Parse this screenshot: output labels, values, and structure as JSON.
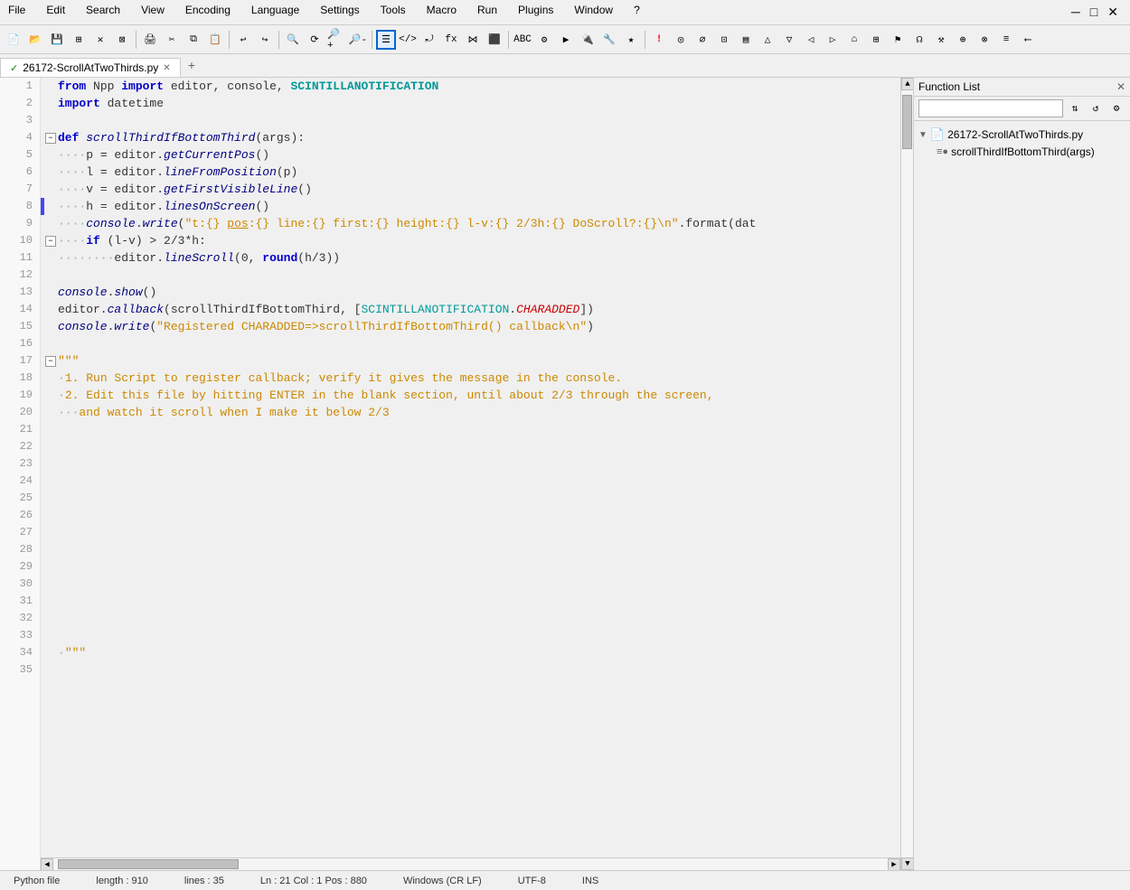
{
  "menubar": {
    "items": [
      "File",
      "Edit",
      "Search",
      "View",
      "Encoding",
      "Language",
      "Settings",
      "Tools",
      "Macro",
      "Run",
      "Plugins",
      "Window",
      "?"
    ]
  },
  "tabbar": {
    "tab": {
      "check": "✓",
      "filename": "26172-ScrollAtTwoThirds.py",
      "close": "✕"
    }
  },
  "function_list": {
    "title": "Function List",
    "close": "✕",
    "search_placeholder": "",
    "tree": {
      "file_icon": "📄",
      "filename": "26172-ScrollAtTwoThirds.py",
      "child_icon": "≡●",
      "child_name": "scrollThirdIfBottomThird(args)"
    }
  },
  "code": {
    "lines": [
      {
        "num": 1,
        "fold": false,
        "gutter": "none",
        "text": "from Npp import editor, console, SCINTILLANOTIFICATION",
        "type": "from"
      },
      {
        "num": 2,
        "fold": false,
        "gutter": "none",
        "text": "import datetime",
        "type": "import"
      },
      {
        "num": 3,
        "fold": false,
        "gutter": "none",
        "text": "",
        "type": "blank"
      },
      {
        "num": 4,
        "fold": true,
        "foldOpen": true,
        "gutter": "none",
        "text": "def scrollThirdIfBottomThird(args):",
        "type": "def"
      },
      {
        "num": 5,
        "fold": false,
        "gutter": "none",
        "text": "    p = editor.getCurrentPos()",
        "type": "code"
      },
      {
        "num": 6,
        "fold": false,
        "gutter": "none",
        "text": "    l = editor.lineFromPosition(p)",
        "type": "code"
      },
      {
        "num": 7,
        "fold": false,
        "gutter": "none",
        "text": "    v = editor.getFirstVisibleLine()",
        "type": "code"
      },
      {
        "num": 8,
        "fold": false,
        "gutter": "blue",
        "text": "    h = editor.linesOnScreen()",
        "type": "code"
      },
      {
        "num": 9,
        "fold": false,
        "gutter": "none",
        "text": "    console.write(\"t:{} pos:{} line:{} first:{} height:{} l-v:{} 2/3h:{} DoScroll?:{}\\n\".format(dat",
        "type": "code"
      },
      {
        "num": 10,
        "fold": true,
        "foldOpen": true,
        "gutter": "none",
        "text": "    if (l-v) > 2/3*h:",
        "type": "if"
      },
      {
        "num": 11,
        "fold": false,
        "gutter": "none",
        "text": "        editor.lineScroll(0, round(h/3))",
        "type": "code"
      },
      {
        "num": 12,
        "fold": false,
        "gutter": "none",
        "text": "",
        "type": "blank"
      },
      {
        "num": 13,
        "fold": false,
        "gutter": "none",
        "text": "console.show()",
        "type": "code"
      },
      {
        "num": 14,
        "fold": false,
        "gutter": "none",
        "text": "editor.callback(scrollThirdIfBottomThird, [SCINTILLANOTIFICATION.CHARADDED])",
        "type": "code"
      },
      {
        "num": 15,
        "fold": false,
        "gutter": "none",
        "text": "console.write(\"Registered CHARADDED=>scrollThirdIfBottomThird() callback\\n\")",
        "type": "code"
      },
      {
        "num": 16,
        "fold": false,
        "gutter": "none",
        "text": "",
        "type": "blank"
      },
      {
        "num": 17,
        "fold": true,
        "foldOpen": true,
        "gutter": "none",
        "text": "\"\"\"",
        "type": "str_open"
      },
      {
        "num": 18,
        "fold": false,
        "gutter": "none",
        "text": "1. Run Script to register callback; verify it gives the message in the console.",
        "type": "str_block"
      },
      {
        "num": 19,
        "fold": false,
        "gutter": "none",
        "text": "2. Edit this file by hitting ENTER in the blank section, until about 2/3 through the screen,",
        "type": "str_block"
      },
      {
        "num": 20,
        "fold": false,
        "gutter": "none",
        "text": "   and watch it scroll when I make it below 2/3",
        "type": "str_block"
      },
      {
        "num": 21,
        "fold": false,
        "gutter": "none",
        "text": "",
        "type": "blank"
      },
      {
        "num": 22,
        "fold": false,
        "gutter": "none",
        "text": "",
        "type": "blank"
      },
      {
        "num": 23,
        "fold": false,
        "gutter": "none",
        "text": "",
        "type": "blank"
      },
      {
        "num": 24,
        "fold": false,
        "gutter": "none",
        "text": "",
        "type": "blank"
      },
      {
        "num": 25,
        "fold": false,
        "gutter": "none",
        "text": "",
        "type": "blank"
      },
      {
        "num": 26,
        "fold": false,
        "gutter": "none",
        "text": "",
        "type": "blank"
      },
      {
        "num": 27,
        "fold": false,
        "gutter": "none",
        "text": "",
        "type": "blank"
      },
      {
        "num": 28,
        "fold": false,
        "gutter": "none",
        "text": "",
        "type": "blank"
      },
      {
        "num": 29,
        "fold": false,
        "gutter": "none",
        "text": "",
        "type": "blank"
      },
      {
        "num": 30,
        "fold": false,
        "gutter": "none",
        "text": "",
        "type": "blank"
      },
      {
        "num": 31,
        "fold": false,
        "gutter": "none",
        "text": "",
        "type": "blank"
      },
      {
        "num": 32,
        "fold": false,
        "gutter": "none",
        "text": "",
        "type": "blank"
      },
      {
        "num": 33,
        "fold": false,
        "gutter": "none",
        "text": "",
        "type": "blank"
      },
      {
        "num": 34,
        "fold": false,
        "gutter": "none",
        "text": "\"\"\"",
        "type": "str_close"
      },
      {
        "num": 35,
        "fold": false,
        "gutter": "none",
        "text": "",
        "type": "blank"
      }
    ]
  },
  "statusbar": {
    "filetype": "Python file",
    "length": "length : 910",
    "lines": "lines : 35",
    "cursor": "Ln : 21    Col : 1    Pos : 880",
    "eol": "Windows (CR LF)",
    "encoding": "UTF-8",
    "mode": "INS"
  },
  "colors": {
    "keyword": "#0000cc",
    "keyword2": "#aa00aa",
    "string_block": "#cc8800",
    "function": "#000080",
    "highlight": "#cc0000",
    "blue_gutter": "#4444ff",
    "green_gutter": "#44aa44"
  }
}
